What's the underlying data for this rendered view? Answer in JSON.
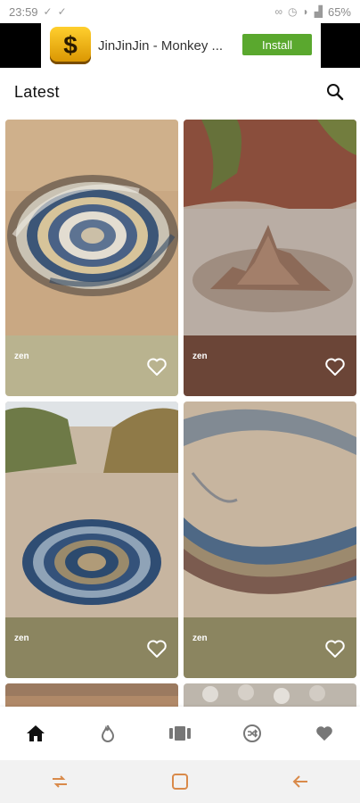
{
  "status_bar": {
    "time": "23:59",
    "battery": "65%"
  },
  "ad": {
    "logo_symbol": "$",
    "title": "JinJinJin - Monkey ...",
    "install_label": "Install"
  },
  "header": {
    "title": "Latest"
  },
  "cards": [
    {
      "label": "zen",
      "caption_color": "#b9b38f"
    },
    {
      "label": "zen",
      "caption_color": "#6b4537"
    },
    {
      "label": "zen",
      "caption_color": "#8b8560"
    },
    {
      "label": "zen",
      "caption_color": "#8b8560"
    }
  ],
  "bottom_nav": [
    "home",
    "trending",
    "collections",
    "shuffle",
    "favorites"
  ],
  "colors": {
    "accent": "#5aa82e",
    "sys_nav_icon": "#d98a4a"
  }
}
